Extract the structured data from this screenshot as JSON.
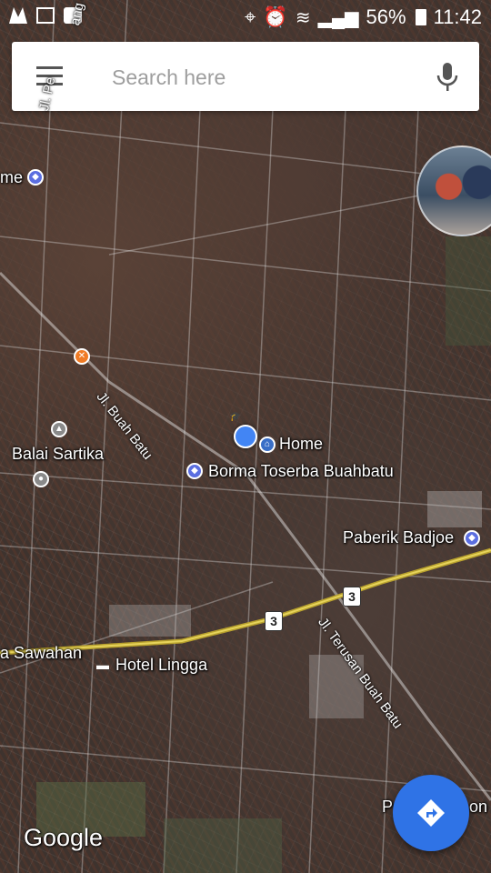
{
  "status_bar": {
    "battery": "56%",
    "time": "11:42",
    "icons": [
      "gallery-icon",
      "image-icon",
      "message-icon",
      "location-icon",
      "alarm-icon",
      "wifi-icon",
      "signal-icon",
      "battery-icon"
    ]
  },
  "search": {
    "placeholder": "Search here",
    "menu_icon": "hamburger-menu-icon",
    "mic_icon": "microphone-icon"
  },
  "map": {
    "labels": {
      "home_left": "me",
      "balai_sartika": "Balai Sartika",
      "home": "Home",
      "borma": "Borma Toserba Buahbatu",
      "paberik": "Paberik Badjoe",
      "sawahan": "a Sawahan",
      "hotel_lingga": "Hotel Lingga",
      "bottom_right": "P",
      "bottom_right_tail": "on"
    },
    "roads": {
      "jl_left": "Jl. Pe",
      "jl_left_tail": "ang 4",
      "jl_buah_batu": "Jl. Buah Batu",
      "jl_terusan": "Jl. Terusan Buah Batu"
    },
    "route_number": "3"
  },
  "branding": {
    "logo": "Google"
  },
  "fab": {
    "icon": "directions-icon",
    "color": "#2f73e6"
  },
  "accent": "#4285f4"
}
